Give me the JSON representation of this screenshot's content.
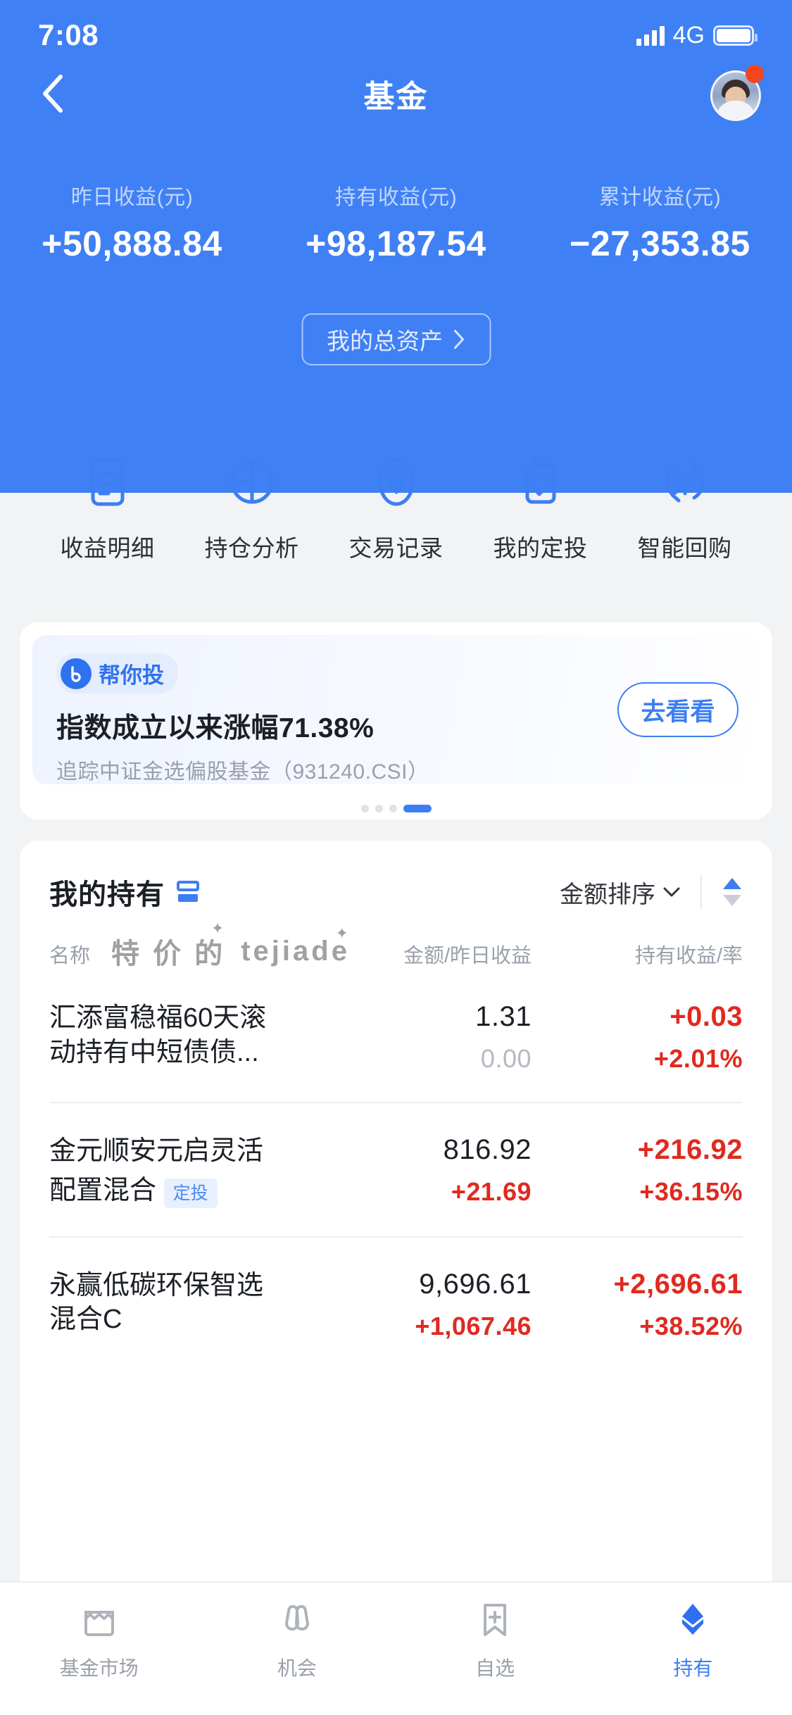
{
  "status": {
    "time": "7:08",
    "network": "4G",
    "signal_icon": "signal-bars-icon",
    "battery_icon": "battery-icon"
  },
  "navbar": {
    "back_icon": "chevron-left-icon",
    "title": "基金",
    "avatar_name": "user-avatar",
    "badge_dot": "notification-dot"
  },
  "summary": {
    "columns": [
      {
        "label": "昨日收益(元)",
        "value": "+50,888.84"
      },
      {
        "label": "持有收益(元)",
        "value": "+98,187.54"
      },
      {
        "label": "累计收益(元)",
        "value": "−27,353.85"
      }
    ],
    "assets_button": "我的总资产",
    "assets_chevron": "chevron-right-icon"
  },
  "quick_actions": [
    {
      "label": "收益明细",
      "icon": "document-lines-icon"
    },
    {
      "label": "持仓分析",
      "icon": "pie-chart-icon"
    },
    {
      "label": "交易记录",
      "icon": "diamond-record-icon"
    },
    {
      "label": "我的定投",
      "icon": "calendar-check-icon"
    },
    {
      "label": "智能回购",
      "icon": "refresh-yen-icon"
    }
  ],
  "promo": {
    "badge_text": "帮你投",
    "badge_logo": "bangnitou-logo-icon",
    "title": "指数成立以来涨幅71.38%",
    "subtitle": "追踪中证金选偏股基金（931240.CSI）",
    "cta": "去看看",
    "dots_total": 4,
    "dots_active_index": 3
  },
  "holdings": {
    "title": "我的持有",
    "title_icon": "list-toggle-icon",
    "sort_label": "金额排序",
    "sort_chevron": "chevron-down-icon",
    "sort_updown_icon": "sort-ascending-icon",
    "columns": [
      "名称",
      "金额/昨日收益",
      "持有收益/率"
    ],
    "watermark": [
      "特 价 的",
      "tejiade"
    ],
    "rows": [
      {
        "name": "汇添富稳福60天滚动持有中短债债...",
        "badge": "",
        "amount": "1.31",
        "yesterday": "0.00",
        "yesterday_state": "gray",
        "profit": "+0.03",
        "rate": "+2.01%"
      },
      {
        "name": "金元顺安元启灵活配置混合",
        "badge": "定投",
        "amount": "816.92",
        "yesterday": "+21.69",
        "yesterday_state": "red",
        "profit": "+216.92",
        "rate": "+36.15%"
      },
      {
        "name": "永赢低碳环保智选混合C",
        "badge": "",
        "amount": "9,696.61",
        "yesterday": "+1,067.46",
        "yesterday_state": "red",
        "profit": "+2,696.61",
        "rate": "+38.52%"
      }
    ]
  },
  "tabbar": [
    {
      "label": "基金市场",
      "icon": "market-shop-icon",
      "active": false
    },
    {
      "label": "机会",
      "icon": "binoculars-icon",
      "active": false
    },
    {
      "label": "自选",
      "icon": "bookmark-plus-icon",
      "active": false
    },
    {
      "label": "持有",
      "icon": "layers-icon",
      "active": true
    }
  ],
  "colors": {
    "brand_blue": "#4080f5",
    "accent_blue": "#3d7ef2",
    "up_red": "#e02a20",
    "muted": "#9aa0ab"
  }
}
